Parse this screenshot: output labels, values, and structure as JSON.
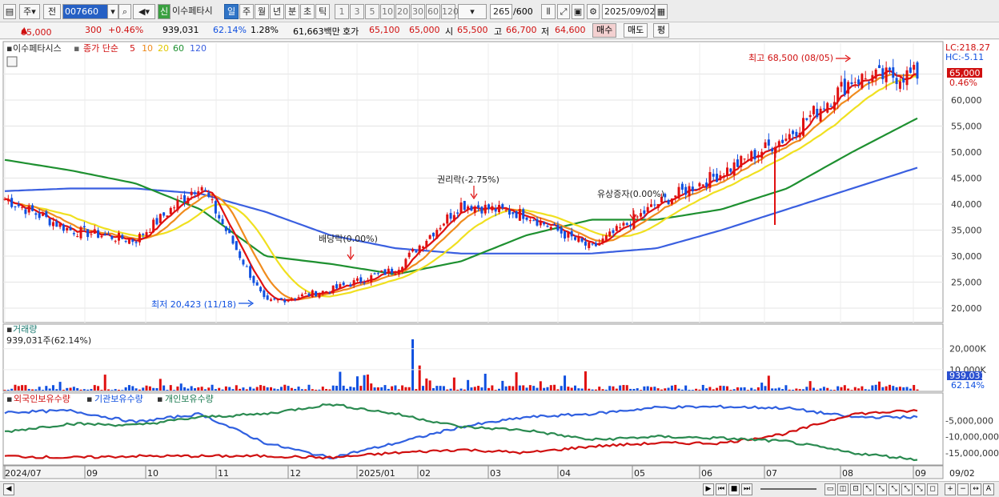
{
  "toolbar": {
    "period_label": "주",
    "compare_label": "전",
    "stock_code": "007660",
    "stock_badge": "신",
    "stock_name": "이수페타시",
    "intervals": [
      "일",
      "주",
      "월",
      "년",
      "분",
      "초",
      "틱"
    ],
    "active_interval": "일",
    "nums": [
      "1",
      "3",
      "5",
      "10",
      "20",
      "30",
      "60",
      "120"
    ],
    "count": "265",
    "count_total": "/600",
    "date": "2025/09/02"
  },
  "quote": {
    "price": "65,000",
    "change": "300",
    "change_pct": "+0.46%",
    "volume": "939,031",
    "volume_ratio": "62.14%",
    "turnover_ratio": "1.28%",
    "amount": "61,663백만",
    "bid_label": "호가",
    "bid": "65,100",
    "ask": "65,000",
    "open_label": "시",
    "open": "65,500",
    "high_label": "고",
    "high": "66,700",
    "low_label": "저",
    "low": "64,600",
    "buy_label": "매수",
    "sell_label": "매도",
    "eval_label": "평"
  },
  "price_panel": {
    "name": "이수페타시스",
    "ma_label": "종가 단순",
    "ma_periods": [
      "5",
      "10",
      "20",
      "60",
      "120"
    ],
    "lc": "LC:218.27",
    "hc": "HC:-5.11",
    "cur_price": "65,000",
    "cur_pct": "0.46%",
    "annotations": {
      "high": "최고 68,500 (08/05)",
      "low": "최저 20,423 (11/18)",
      "dividend": "배당락(0.00%)",
      "rights": "권리락(-2.75%)",
      "increase": "유상증자(0.00%)"
    }
  },
  "volume_panel": {
    "name": "거래량",
    "value_label": "939,031주(62.14%)",
    "cur_value": "939,031",
    "cur_pct": "62.14%"
  },
  "holders_panel": {
    "legends": [
      "외국인보유수량",
      "기관보유수량",
      "개인보유수량"
    ]
  },
  "x_labels": [
    "2024/07",
    "09",
    "10",
    "11",
    "12",
    "2025/01",
    "02",
    "03",
    "04",
    "05",
    "06",
    "07",
    "08",
    "09",
    "09/02"
  ],
  "colors": {
    "up": "#e01010",
    "down": "#1050e0",
    "ma5": "#e01010",
    "ma10": "#f08c1e",
    "ma20": "#f0e020",
    "ma60": "#1e9030",
    "ma120": "#3a5fe0",
    "foreign": "#3060e0",
    "institution": "#d01010",
    "individual": "#2a8a50"
  },
  "chart_data": [
    {
      "type": "candlestick",
      "title": "이수페타시스",
      "x": [
        "2024/07",
        "2024/08",
        "2024/09",
        "2024/10",
        "2024/11",
        "2024/12",
        "2025/01",
        "2025/02",
        "2025/03",
        "2025/04",
        "2025/05",
        "2025/06",
        "2025/07",
        "2025/08",
        "2025/09"
      ],
      "series": [
        {
          "name": "종가",
          "values": [
            41000,
            35000,
            33000,
            44000,
            21000,
            23500,
            27500,
            40000,
            38000,
            31500,
            40000,
            46000,
            53000,
            64000,
            65000
          ]
        },
        {
          "name": "60",
          "values": [
            48500,
            46500,
            44000,
            39000,
            30000,
            28500,
            26500,
            29000,
            34000,
            37000,
            37000,
            39000,
            43000,
            50000,
            56500
          ]
        },
        {
          "name": "120",
          "values": [
            42500,
            43000,
            43000,
            42000,
            38500,
            34000,
            31500,
            30500,
            30500,
            30500,
            31500,
            35000,
            39000,
            43000,
            47000
          ]
        }
      ],
      "ylim": [
        18000,
        70000
      ],
      "yticks": [
        "65,000",
        "60,000",
        "55,000",
        "50,000",
        "45,000",
        "40,000",
        "35,000",
        "30,000",
        "25,000",
        "20,000"
      ],
      "high": 68500,
      "low": 20423
    },
    {
      "type": "bar",
      "title": "거래량",
      "yticks": [
        "20,000K",
        "10,000K"
      ],
      "last": 939031
    },
    {
      "type": "line",
      "series": [
        {
          "name": "외국인보유수량",
          "values": [
            -2500000,
            -2000000,
            -5500000,
            -3000000,
            -12000000,
            -16500000,
            -12000000,
            -7000000,
            -4000000,
            -3000000,
            -1000000,
            -800000,
            -1200000,
            -4000000,
            -4000000
          ]
        },
        {
          "name": "기관보유수량",
          "values": [
            -16000000,
            -16500000,
            -16000000,
            -16000000,
            -16000000,
            -16500000,
            -15000000,
            -14000000,
            -15000000,
            -13000000,
            -12000000,
            -12000000,
            -9000000,
            -3000000,
            -2000000
          ]
        },
        {
          "name": "개인보유수량",
          "values": [
            -8500000,
            -6000000,
            -6500000,
            -4000000,
            -3000000,
            0,
            -3000000,
            -7000000,
            -8000000,
            -11000000,
            -10000000,
            -10500000,
            -11500000,
            -15000000,
            -17000000
          ]
        }
      ],
      "yticks": [
        "-5,000,000",
        "-10,000,000",
        "-15,000,000"
      ]
    }
  ]
}
